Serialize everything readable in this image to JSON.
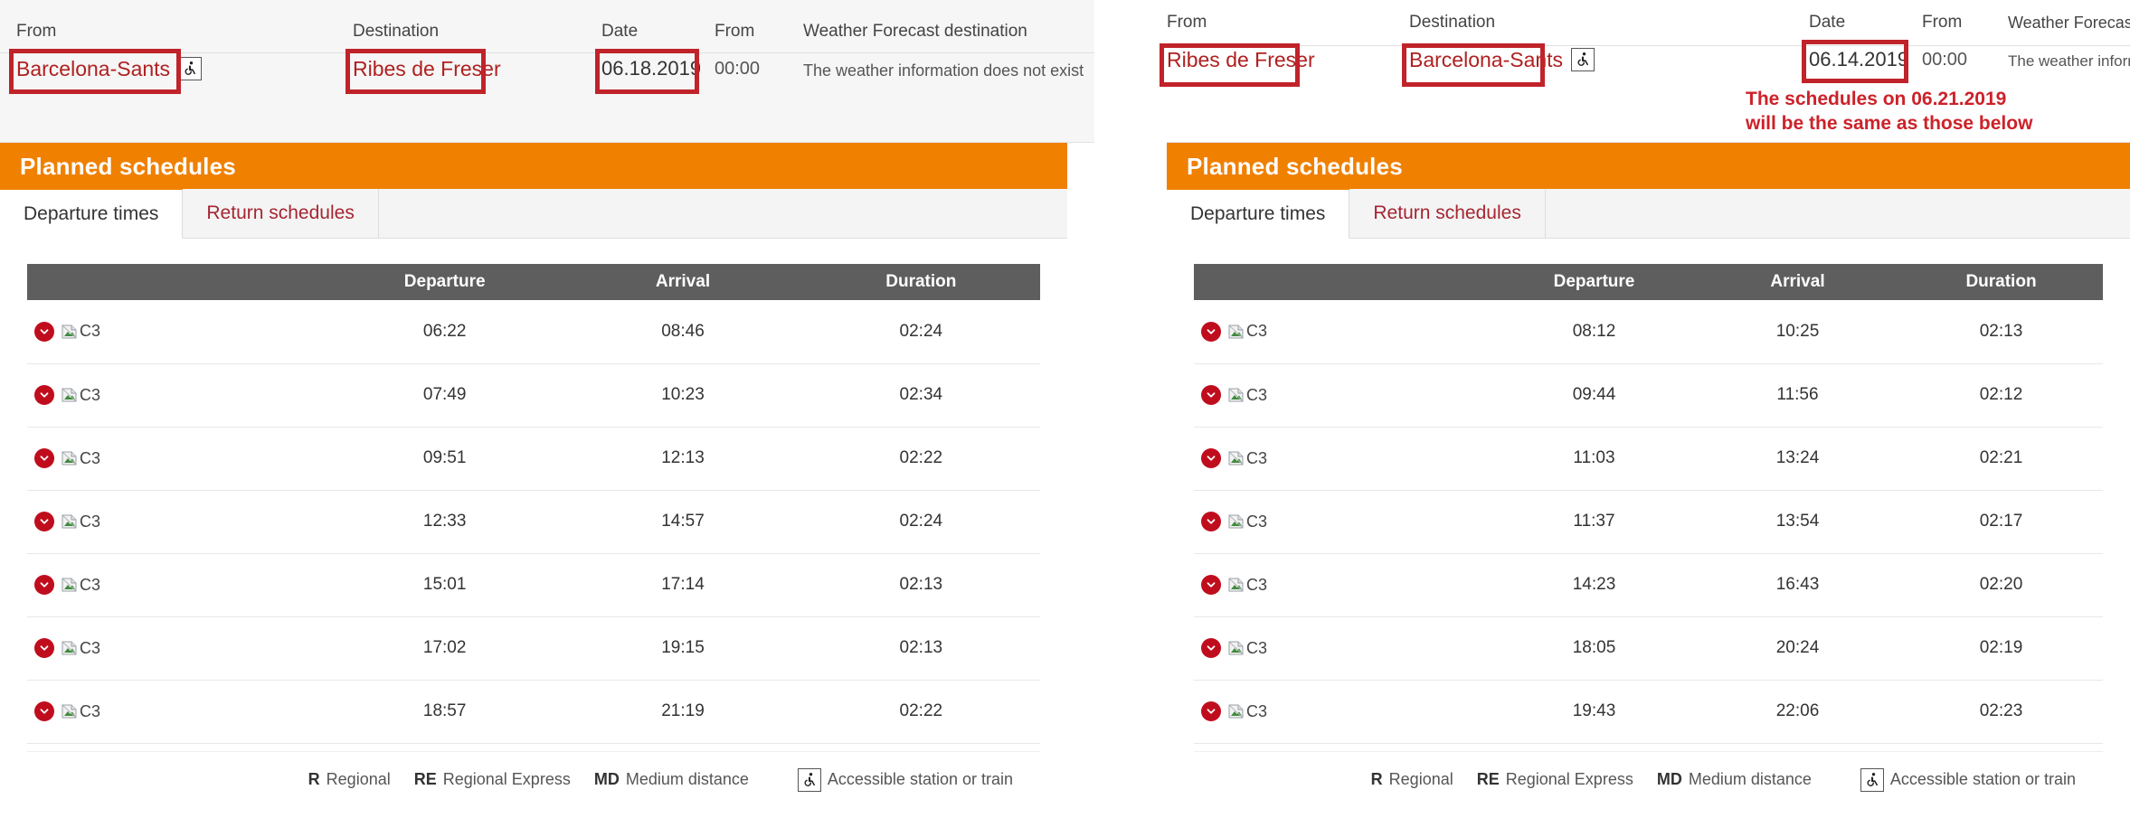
{
  "left": {
    "summary": {
      "fields": [
        {
          "label": "From",
          "value": "Barcelona-Sants",
          "accessible": true,
          "kind": "station",
          "highlighted": true
        },
        {
          "label": "Destination",
          "value": "Ribes de Freser",
          "accessible": false,
          "kind": "station",
          "highlighted": true
        },
        {
          "label": "Date",
          "value": "06.18.2019",
          "accessible": false,
          "kind": "date",
          "highlighted": true
        },
        {
          "label": "From",
          "value": "00:00",
          "accessible": false,
          "kind": "time",
          "highlighted": false
        },
        {
          "label": "Weather Forecast destination",
          "value": "The weather information does not exist",
          "accessible": false,
          "kind": "weather",
          "highlighted": false
        }
      ]
    },
    "section_title": "Planned schedules",
    "tabs": [
      {
        "label": "Departure times",
        "active": true
      },
      {
        "label": "Return schedules",
        "active": false
      }
    ],
    "table": {
      "columns": [
        "",
        "Departure",
        "Arrival",
        "Duration"
      ],
      "rows": [
        {
          "line": "C3",
          "departure": "06:22",
          "arrival": "08:46",
          "duration": "02:24"
        },
        {
          "line": "C3",
          "departure": "07:49",
          "arrival": "10:23",
          "duration": "02:34"
        },
        {
          "line": "C3",
          "departure": "09:51",
          "arrival": "12:13",
          "duration": "02:22"
        },
        {
          "line": "C3",
          "departure": "12:33",
          "arrival": "14:57",
          "duration": "02:24"
        },
        {
          "line": "C3",
          "departure": "15:01",
          "arrival": "17:14",
          "duration": "02:13"
        },
        {
          "line": "C3",
          "departure": "17:02",
          "arrival": "19:15",
          "duration": "02:13"
        },
        {
          "line": "C3",
          "departure": "18:57",
          "arrival": "21:19",
          "duration": "02:22"
        }
      ]
    },
    "legend": [
      {
        "code": "R",
        "text": "Regional"
      },
      {
        "code": "RE",
        "text": "Regional Express"
      },
      {
        "code": "MD",
        "text": "Medium distance"
      }
    ],
    "legend_accessible": "Accessible station or train"
  },
  "right": {
    "summary": {
      "fields": [
        {
          "label": "From",
          "value": "Ribes de Freser",
          "accessible": false,
          "kind": "station",
          "highlighted": true
        },
        {
          "label": "Destination",
          "value": "Barcelona-Sants",
          "accessible": true,
          "kind": "station",
          "highlighted": true
        },
        {
          "label": "Date",
          "value": "06.14.2019",
          "accessible": false,
          "kind": "date",
          "highlighted": true
        },
        {
          "label": "From",
          "value": "00:00",
          "accessible": false,
          "kind": "time",
          "highlighted": false
        },
        {
          "label": "Weather Forecast destination",
          "value": "The weather information does not exist",
          "accessible": false,
          "kind": "weather",
          "highlighted": false
        }
      ],
      "annotation": "The schedules on 06.21.2019\nwill be the same as those below"
    },
    "section_title": "Planned schedules",
    "tabs": [
      {
        "label": "Departure times",
        "active": true
      },
      {
        "label": "Return schedules",
        "active": false
      }
    ],
    "table": {
      "columns": [
        "",
        "Departure",
        "Arrival",
        "Duration"
      ],
      "rows": [
        {
          "line": "C3",
          "departure": "08:12",
          "arrival": "10:25",
          "duration": "02:13"
        },
        {
          "line": "C3",
          "departure": "09:44",
          "arrival": "11:56",
          "duration": "02:12"
        },
        {
          "line": "C3",
          "departure": "11:03",
          "arrival": "13:24",
          "duration": "02:21"
        },
        {
          "line": "C3",
          "departure": "11:37",
          "arrival": "13:54",
          "duration": "02:17"
        },
        {
          "line": "C3",
          "departure": "14:23",
          "arrival": "16:43",
          "duration": "02:20"
        },
        {
          "line": "C3",
          "departure": "18:05",
          "arrival": "20:24",
          "duration": "02:19"
        },
        {
          "line": "C3",
          "departure": "19:43",
          "arrival": "22:06",
          "duration": "02:23"
        }
      ]
    },
    "legend": [
      {
        "code": "R",
        "text": "Regional"
      },
      {
        "code": "RE",
        "text": "Regional Express"
      },
      {
        "code": "MD",
        "text": "Medium distance"
      }
    ],
    "legend_accessible": "Accessible station or train"
  },
  "colors": {
    "accent_orange": "#f08000",
    "annotation_red": "#cc2229",
    "highlight_box_red": "#c0232a",
    "station_text_red": "#b02020",
    "table_header_gray": "#5e5e5e",
    "expand_dot_red": "#c00d1e"
  }
}
